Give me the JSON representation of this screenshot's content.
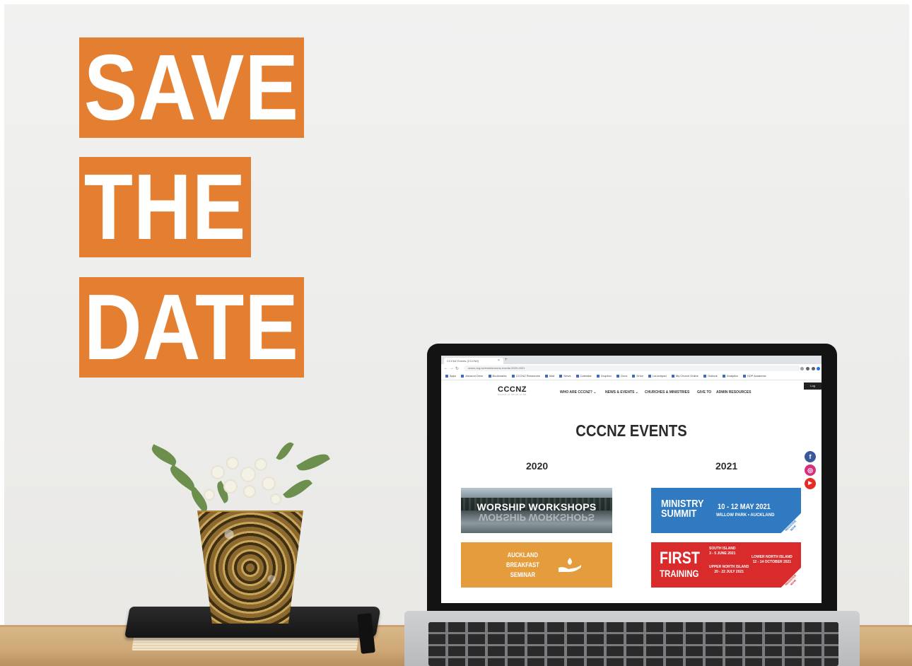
{
  "poster": {
    "line1": "SAVE",
    "line2": "THE",
    "line3": "DATE",
    "accent": "#e47f32"
  },
  "browser": {
    "tab_title": "CCCNZ Events (CCCNZ)",
    "url": "cccnz.org.nz/events/cccnz-events-2020-2021",
    "bookmarks": [
      "Apps",
      "Amazon Drive",
      "Bookmarks",
      "CCCNZ Resources",
      "Mail",
      "News",
      "Calendar",
      "Dropbox",
      "Docs",
      "Drive",
      "Launchpad",
      "My Church Online",
      "Outlook",
      "Analytics",
      "KDP Academic"
    ]
  },
  "site": {
    "logo": "CCCNZ",
    "logo_tagline": "Church of Christ in NZ",
    "nav": [
      "WHO ARE CCCNZ? ⌄",
      "NEWS & EVENTS ⌄",
      "CHURCHES & MINISTRIES",
      "GIVE TO",
      "ADMIN RESOURCES"
    ],
    "login": "Log"
  },
  "page": {
    "title": "CCCNZ EVENTS",
    "year_left": "2020",
    "year_right": "2021"
  },
  "events": {
    "worship": {
      "title": "WORSHIP WORKSHOPS"
    },
    "ministry": {
      "line1": "MINISTRY",
      "line2": "SUMMIT",
      "date": "10 - 12 MAY 2021",
      "location": "WILLOW PARK • AUCKLAND",
      "corner": "REGISTER NOW"
    },
    "breakfast": {
      "line1": "AUCKLAND",
      "line2": "BREAKFAST",
      "line3": "SEMINAR"
    },
    "first": {
      "line1": "FIRST",
      "line2": "TRAINING",
      "south_label": "SOUTH ISLAND",
      "south_date": "3 - 5 JUNE 2021",
      "upper_label": "UPPER NORTH ISLAND",
      "upper_date": "20 - 22 JULY 2021",
      "lower_label": "LOWER NORTH ISLAND",
      "lower_date": "12 - 14 OCTOBER 2021",
      "corner": "REGISTER NOW"
    }
  },
  "social": {
    "facebook": "f",
    "instagram": "◎",
    "youtube": "▶",
    "colors": {
      "facebook": "#3b5998",
      "instagram": "#d6307d",
      "youtube": "#e52d27"
    }
  }
}
